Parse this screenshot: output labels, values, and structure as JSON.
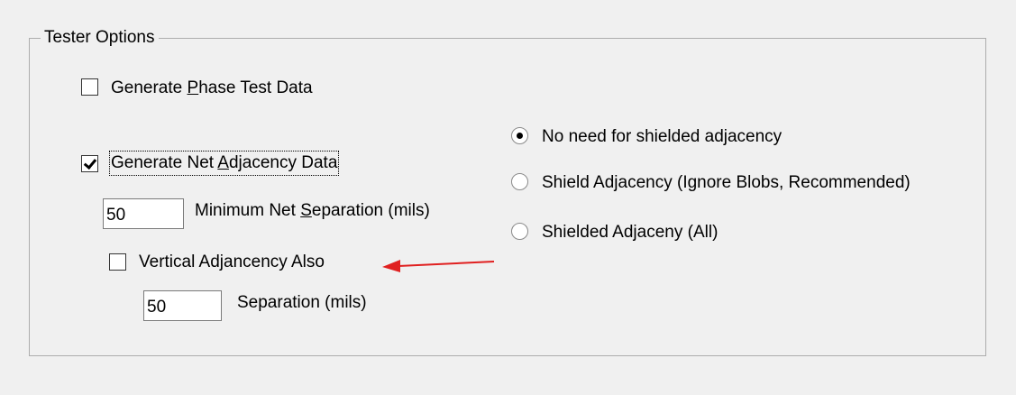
{
  "group": {
    "title": "Tester Options"
  },
  "options": {
    "phase_test": {
      "label_before": "Generate ",
      "label_mnemonic": "P",
      "label_after": "hase Test Data",
      "checked": false
    },
    "net_adjacency": {
      "label_before": "Generate Net ",
      "label_mnemonic": "A",
      "label_after": "djacency Data",
      "checked": true
    },
    "min_separation": {
      "value": "50",
      "label_before": "Minimum Net ",
      "label_mnemonic": "S",
      "label_after": "eparation (mils)"
    },
    "vertical_adjacency": {
      "label": "Vertical Adjancency Also",
      "checked": false
    },
    "vertical_separation": {
      "value": "50",
      "label": "Separation (mils)"
    }
  },
  "shielding": {
    "options": [
      {
        "label": "No need for shielded adjacency",
        "selected": true
      },
      {
        "label": "Shield Adjacency (Ignore Blobs, Recommended)",
        "selected": false
      },
      {
        "label": "Shielded Adjaceny (All)",
        "selected": false
      }
    ]
  },
  "annotation": {
    "arrow_color": "#e02020"
  }
}
